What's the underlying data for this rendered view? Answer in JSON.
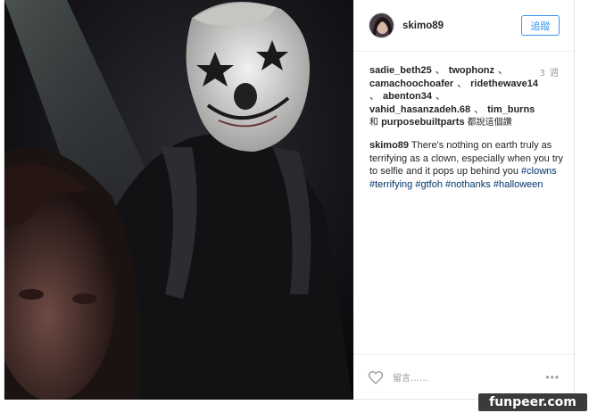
{
  "post": {
    "author": {
      "username": "skimo89",
      "avatar_icon": "avatar-photo-icon"
    },
    "follow_label": "追蹤",
    "timestamp": "3 週",
    "likes": {
      "names": [
        "sadie_beth25",
        "twophonz",
        "camachoochoafer",
        "ridethewave14",
        "abenton34",
        "vahid_hasanzadeh.68",
        "tim_burns"
      ],
      "separator": "、",
      "conjunction": "和",
      "last_name": "purposebuiltparts",
      "suffix": "都說這個讚"
    },
    "caption": {
      "username": "skimo89",
      "text": "There's nothing on earth truly as terrifying as a clown, especially when you try to selfie and it pops up behind you",
      "hashtags": [
        "#clowns",
        "#terrifying",
        "#gtfoh",
        "#nothanks",
        "#halloween"
      ]
    },
    "footer": {
      "comment_placeholder": "留言……",
      "more_label": "•••",
      "like_icon": "heart-outline-icon"
    }
  },
  "watermark": "funpeer.com",
  "colors": {
    "link_blue": "#3897f0",
    "hashtag": "#003569",
    "meta_gray": "#999999"
  }
}
